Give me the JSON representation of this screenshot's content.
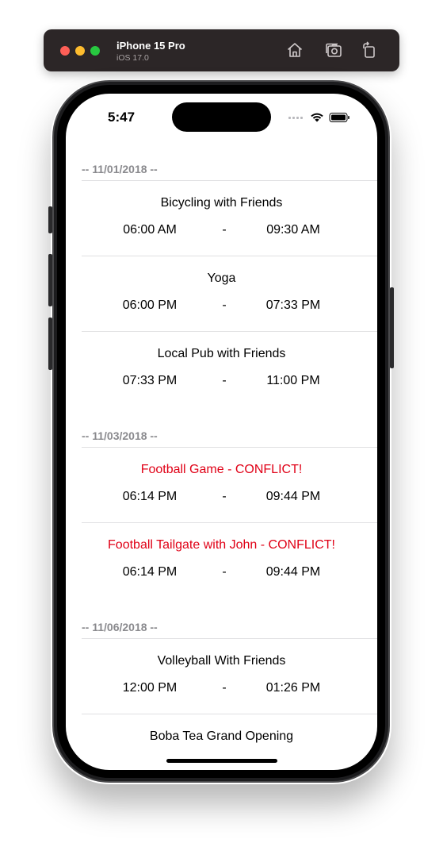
{
  "simulator": {
    "device_name": "iPhone 15 Pro",
    "os_version": "iOS 17.0",
    "icons": [
      "home-icon",
      "screenshot-icon",
      "rotate-icon"
    ]
  },
  "status_bar": {
    "time": "5:47",
    "icons": [
      "signal-icon",
      "wifi-icon",
      "battery-icon"
    ]
  },
  "sections": [
    {
      "header": "-- 11/01/2018 --",
      "events": [
        {
          "title": "Bicycling with Friends",
          "start": "06:00 AM",
          "separator": "-",
          "end": "09:30 AM",
          "conflict": false
        },
        {
          "title": "Yoga",
          "start": "06:00 PM",
          "separator": "-",
          "end": "07:33 PM",
          "conflict": false
        },
        {
          "title": "Local Pub with Friends",
          "start": "07:33 PM",
          "separator": "-",
          "end": "11:00 PM",
          "conflict": false
        }
      ]
    },
    {
      "header": "-- 11/03/2018 --",
      "events": [
        {
          "title": "Football Game - CONFLICT!",
          "start": "06:14 PM",
          "separator": "-",
          "end": "09:44 PM",
          "conflict": true
        },
        {
          "title": "Football Tailgate with John - CONFLICT!",
          "start": "06:14 PM",
          "separator": "-",
          "end": "09:44 PM",
          "conflict": true
        }
      ]
    },
    {
      "header": "-- 11/06/2018 --",
      "events": [
        {
          "title": "Volleyball With Friends",
          "start": "12:00 PM",
          "separator": "-",
          "end": "01:26 PM",
          "conflict": false
        },
        {
          "title": "Boba Tea Grand Opening",
          "start": "",
          "separator": "",
          "end": "",
          "conflict": false
        }
      ]
    }
  ],
  "colors": {
    "conflict": "#e00016",
    "section_header": "#8a8a8e",
    "separator": "#e0e0e2"
  }
}
